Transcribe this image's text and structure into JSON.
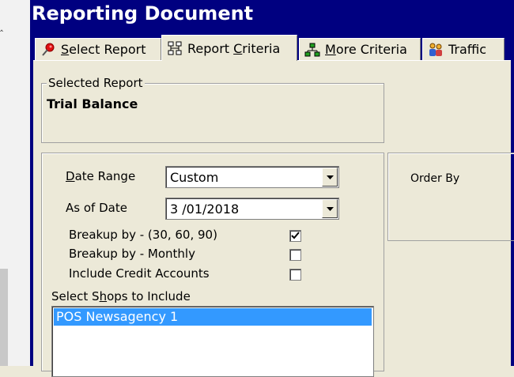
{
  "window": {
    "title": "Reporting Document"
  },
  "tabs": [
    {
      "pre": "",
      "ul": "S",
      "post": "elect Report",
      "icon": "pin-icon",
      "active": false
    },
    {
      "pre": "Report ",
      "ul": "C",
      "post": "riteria",
      "icon": "hierarchy-icon",
      "active": true
    },
    {
      "pre": "",
      "ul": "M",
      "post": "ore Criteria",
      "icon": "network-icon",
      "active": false
    },
    {
      "pre": "",
      "ul": "",
      "post": "Traffic",
      "icon": "people-icon",
      "active": false
    }
  ],
  "selected_report": {
    "legend": "Selected Report",
    "value": "Trial Balance"
  },
  "criteria": {
    "date_range": {
      "label_ul": "D",
      "label_rest": "ate Range",
      "value": "Custom"
    },
    "as_of_date": {
      "label": "As of Date",
      "value": "3 /01/2018"
    },
    "checks": [
      {
        "label": "Breakup by - (30, 60, 90)",
        "checked": true
      },
      {
        "label": "Breakup by - Monthly",
        "checked": false
      },
      {
        "label": "Include Credit Accounts",
        "checked": false
      }
    ],
    "shops": {
      "label_pre": "Select S",
      "label_ul": "h",
      "label_post": "ops to Include",
      "items": [
        "POS Newsagency 1"
      ]
    }
  },
  "order_by": {
    "label": "Order By"
  },
  "colors": {
    "title_bar": "#000080",
    "selection": "#3399ff",
    "face": "#ece9d8"
  }
}
